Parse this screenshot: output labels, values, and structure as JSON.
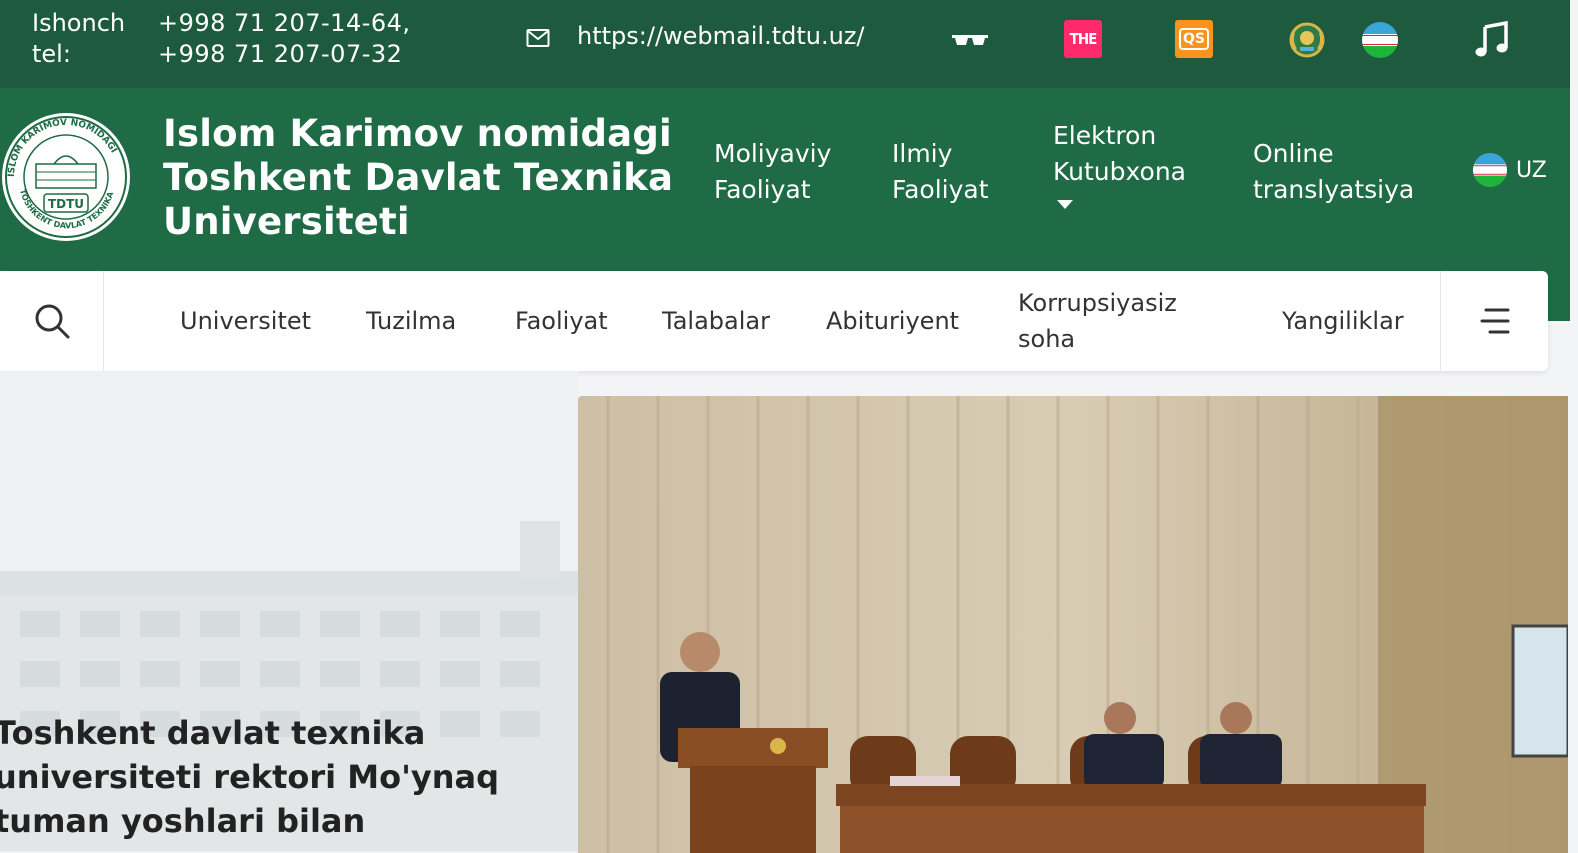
{
  "topbar": {
    "hotline_label": "Ishonch tel:",
    "phone_1": "+998 71 207-14-64,",
    "phone_2": "+998 71 207-07-32",
    "webmail": "https://webmail.tdtu.uz/",
    "icons": [
      "mail-icon",
      "glasses-icon",
      "the-ranking-icon",
      "qs-ranking-icon",
      "state-emblem-icon",
      "uzbekistan-flag-icon",
      "music-icon"
    ],
    "the_label": "THE",
    "qs_label": "QS"
  },
  "header": {
    "title": "Islom Karimov nomidagi Toshkent Davlat Texnika Universiteti",
    "logo_text": "TDTU",
    "nav": [
      {
        "label": "Moliyaviy Faoliyat"
      },
      {
        "label": "Ilmiy Faoliyat"
      },
      {
        "label": "Elektron Kutubxona"
      },
      {
        "label": "Online translyatsiya"
      }
    ],
    "language": "UZ"
  },
  "subnav": {
    "items": [
      {
        "label": "Universitet"
      },
      {
        "label": "Tuzilma"
      },
      {
        "label": "Faoliyat"
      },
      {
        "label": "Talabalar"
      },
      {
        "label": "Abituriyent"
      },
      {
        "label": "Korrupsiyasiz soha"
      },
      {
        "label": "Yangiliklar"
      }
    ]
  },
  "hero": {
    "headline": "Toshkent davlat texnika universiteti rektori Mo'ynaq tuman yoshlari bilan"
  },
  "colors": {
    "topbar": "#1e5a3e",
    "header": "#1e6b45",
    "subnav_bg": "#ffffff"
  }
}
